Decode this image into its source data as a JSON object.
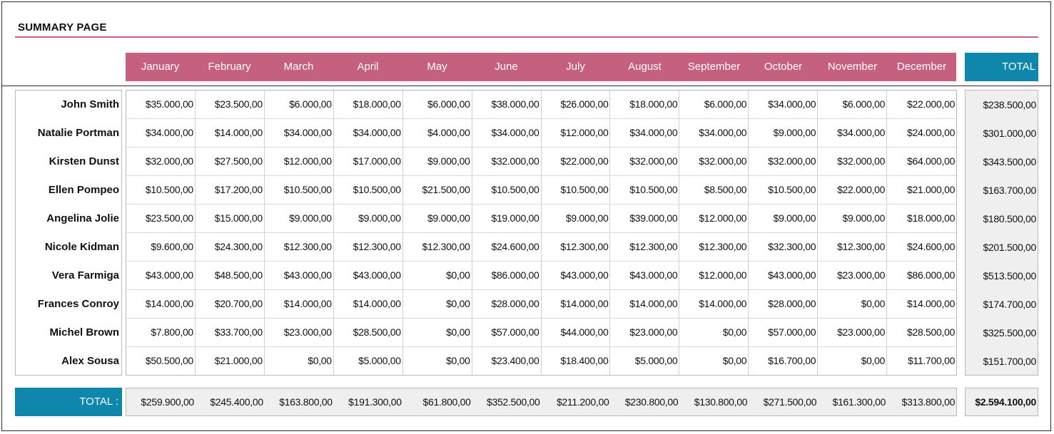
{
  "page": {
    "title": "SUMMARY PAGE"
  },
  "table": {
    "months": [
      "January",
      "February",
      "March",
      "April",
      "May",
      "June",
      "July",
      "August",
      "September",
      "October",
      "November",
      "December"
    ],
    "total_header": "TOTAL",
    "rows": [
      {
        "name": "John Smith",
        "values": [
          "$35.000,00",
          "$23.500,00",
          "$6.000,00",
          "$18.000,00",
          "$6.000,00",
          "$38.000,00",
          "$26.000,00",
          "$18.000,00",
          "$6.000,00",
          "$34.000,00",
          "$6.000,00",
          "$22.000,00"
        ],
        "total": "$238.500,00"
      },
      {
        "name": "Natalie Portman",
        "values": [
          "$34.000,00",
          "$14.000,00",
          "$34.000,00",
          "$34.000,00",
          "$4.000,00",
          "$34.000,00",
          "$12.000,00",
          "$34.000,00",
          "$34.000,00",
          "$9.000,00",
          "$34.000,00",
          "$24.000,00"
        ],
        "total": "$301.000,00"
      },
      {
        "name": "Kirsten Dunst",
        "values": [
          "$32.000,00",
          "$27.500,00",
          "$12.000,00",
          "$17.000,00",
          "$9.000,00",
          "$32.000,00",
          "$22.000,00",
          "$32.000,00",
          "$32.000,00",
          "$32.000,00",
          "$32.000,00",
          "$64.000,00"
        ],
        "total": "$343.500,00"
      },
      {
        "name": "Ellen Pompeo",
        "values": [
          "$10.500,00",
          "$17.200,00",
          "$10.500,00",
          "$10.500,00",
          "$21.500,00",
          "$10.500,00",
          "$10.500,00",
          "$10.500,00",
          "$8.500,00",
          "$10.500,00",
          "$22.000,00",
          "$21.000,00"
        ],
        "total": "$163.700,00"
      },
      {
        "name": "Angelina Jolie",
        "values": [
          "$23.500,00",
          "$15.000,00",
          "$9.000,00",
          "$9.000,00",
          "$9.000,00",
          "$19.000,00",
          "$9.000,00",
          "$39.000,00",
          "$12.000,00",
          "$9.000,00",
          "$9.000,00",
          "$18.000,00"
        ],
        "total": "$180.500,00"
      },
      {
        "name": "Nicole Kidman",
        "values": [
          "$9.600,00",
          "$24.300,00",
          "$12.300,00",
          "$12.300,00",
          "$12.300,00",
          "$24.600,00",
          "$12.300,00",
          "$12.300,00",
          "$12.300,00",
          "$32.300,00",
          "$12.300,00",
          "$24.600,00"
        ],
        "total": "$201.500,00"
      },
      {
        "name": "Vera Farmiga",
        "values": [
          "$43.000,00",
          "$48.500,00",
          "$43.000,00",
          "$43.000,00",
          "$0,00",
          "$86.000,00",
          "$43.000,00",
          "$43.000,00",
          "$12.000,00",
          "$43.000,00",
          "$23.000,00",
          "$86.000,00"
        ],
        "total": "$513.500,00"
      },
      {
        "name": "Frances Conroy",
        "values": [
          "$14.000,00",
          "$20.700,00",
          "$14.000,00",
          "$14.000,00",
          "$0,00",
          "$28.000,00",
          "$14.000,00",
          "$14.000,00",
          "$14.000,00",
          "$28.000,00",
          "$0,00",
          "$14.000,00"
        ],
        "total": "$174.700,00"
      },
      {
        "name": "Michel Brown",
        "values": [
          "$7.800,00",
          "$33.700,00",
          "$23.000,00",
          "$28.500,00",
          "$0,00",
          "$57.000,00",
          "$44.000,00",
          "$23.000,00",
          "$0,00",
          "$57.000,00",
          "$23.000,00",
          "$28.500,00"
        ],
        "total": "$325.500,00"
      },
      {
        "name": "Alex Sousa",
        "values": [
          "$50.500,00",
          "$21.000,00",
          "$0,00",
          "$5.000,00",
          "$0,00",
          "$23.400,00",
          "$18.400,00",
          "$5.000,00",
          "$0,00",
          "$16.700,00",
          "$0,00",
          "$11.700,00"
        ],
        "total": "$151.700,00"
      }
    ],
    "footer": {
      "label": "TOTAL :",
      "monthly_totals": [
        "$259.900,00",
        "$245.400,00",
        "$163.800,00",
        "$191.300,00",
        "$61.800,00",
        "$352.500,00",
        "$211.200,00",
        "$230.800,00",
        "$130.800,00",
        "$271.500,00",
        "$161.300,00",
        "$313.800,00"
      ],
      "grand_total": "$2.594.100,00"
    }
  },
  "colors": {
    "accent_pink": "#c5617f",
    "accent_blue": "#0f86ab",
    "total_bg": "#efefef"
  }
}
